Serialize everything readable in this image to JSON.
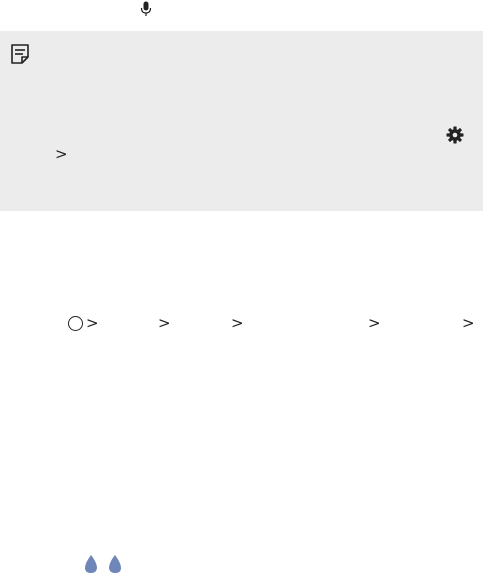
{
  "icons": {
    "mic": "microphone-icon",
    "note": "note-icon",
    "settings": "gear-icon",
    "home": "home-button-icon",
    "earbuds": "earbuds-icon"
  },
  "note_box": {
    "chevron": ">"
  },
  "path_row": {
    "separators": [
      ">",
      ">",
      ">",
      ">",
      ">"
    ]
  },
  "colors": {
    "note_background": "#ececec",
    "earbud_fill": "#6e86b8"
  }
}
